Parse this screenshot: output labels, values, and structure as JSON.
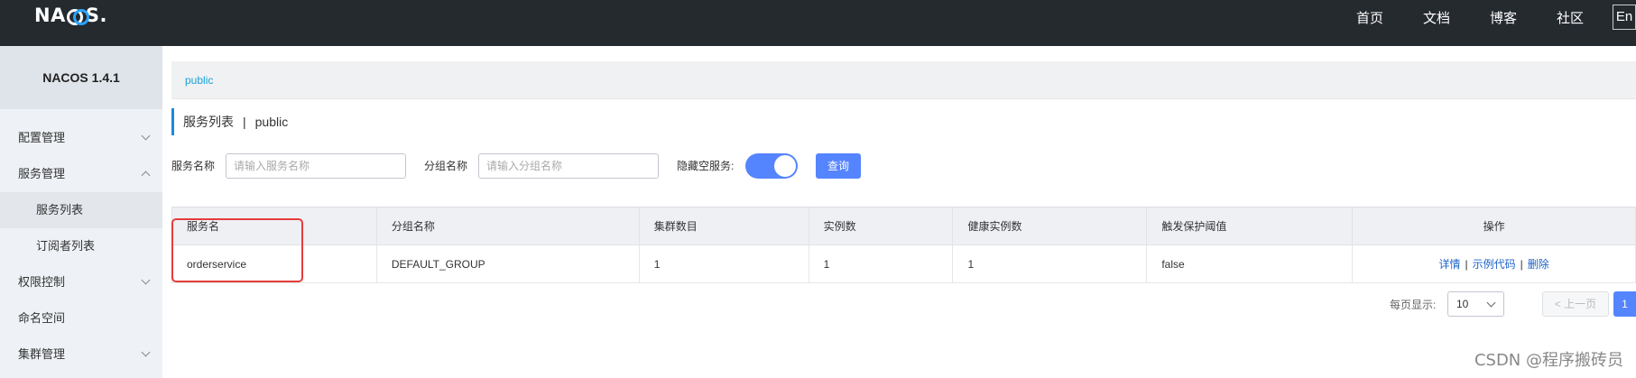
{
  "header": {
    "logo_parts": [
      "NA",
      "S."
    ],
    "nav": [
      "首页",
      "文档",
      "博客",
      "社区"
    ],
    "lang_button": "En"
  },
  "sidebar": {
    "version": "NACOS 1.4.1",
    "items": [
      {
        "label": "配置管理",
        "expanded": false
      },
      {
        "label": "服务管理",
        "expanded": true
      },
      {
        "label": "权限控制",
        "expanded": false
      },
      {
        "label": "命名空间"
      },
      {
        "label": "集群管理",
        "expanded": false
      }
    ],
    "subitems": [
      {
        "label": "服务列表",
        "active": true
      },
      {
        "label": "订阅者列表"
      }
    ]
  },
  "main": {
    "breadcrumb": "public",
    "title": "服务列表",
    "title_sep": "|",
    "title_namespace": "public",
    "filters": {
      "service_name_label": "服务名称",
      "service_name_placeholder": "请输入服务名称",
      "group_name_label": "分组名称",
      "group_name_placeholder": "请输入分组名称",
      "hide_empty_label": "隐藏空服务:",
      "hide_empty_on": true,
      "query_button": "查询"
    },
    "table": {
      "columns": [
        "服务名",
        "分组名称",
        "集群数目",
        "实例数",
        "健康实例数",
        "触发保护阈值",
        "操作"
      ],
      "rows": [
        {
          "service_name": "orderservice",
          "group_name": "DEFAULT_GROUP",
          "cluster_count": "1",
          "instance_count": "1",
          "healthy_count": "1",
          "protect_threshold": "false",
          "actions": {
            "detail": "详情",
            "sample_code": "示例代码",
            "delete": "删除",
            "sep": "|"
          }
        }
      ]
    },
    "pagination": {
      "page_size_label": "每页显示:",
      "page_size": "10",
      "prev": "< 上一页",
      "current_page": "1"
    }
  },
  "watermark": "CSDN @程序搬砖员",
  "colors": {
    "header_bg": "#252a2f",
    "accent": "#5584ff",
    "link": "#1d63c9",
    "highlight_box": "#e53c3c"
  }
}
